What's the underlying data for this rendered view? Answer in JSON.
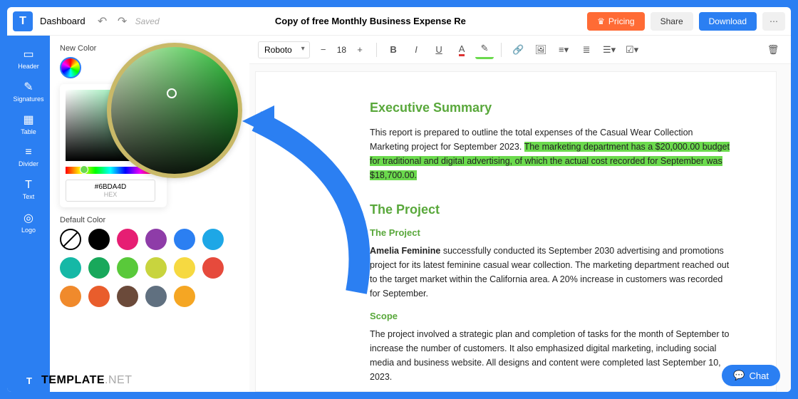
{
  "topbar": {
    "dashboard": "Dashboard",
    "saved": "Saved",
    "title": "Copy of free Monthly Business Expense Re",
    "pricing": "Pricing",
    "share": "Share",
    "download": "Download"
  },
  "sidebar": {
    "items": [
      {
        "label": "Header"
      },
      {
        "label": "Signatures"
      },
      {
        "label": "Table"
      },
      {
        "label": "Divider"
      },
      {
        "label": "Text"
      },
      {
        "label": "Logo"
      }
    ]
  },
  "panel": {
    "newColorLabel": "New Color",
    "hex": "#6BDA4D",
    "hexLabel": "HEX",
    "defaultColorLabel": "Default Color",
    "swatches": [
      "#000000",
      "#e61e73",
      "#8e3ca8",
      "#2b7ff2",
      "#1ea7e6",
      "#15b8a6",
      "#18a85b",
      "#59c93a",
      "#c8d43e",
      "#f6d941",
      "#e64a3c",
      "#f08a2c",
      "#e95d2c",
      "#6b4a3a",
      "#607080",
      "#f5a623"
    ]
  },
  "toolbar": {
    "font": "Roboto",
    "size": "18"
  },
  "doc": {
    "h1": "Executive Summary",
    "p1a": "This report is prepared to outline the total expenses of the Casual Wear Collection Marketing project for September 2023. ",
    "p1b": "The marketing department has a $20,000.00 budget for traditional and digital advertising, of which the actual cost recorded for September was $18,700.00.",
    "h2": "The Project",
    "sh1": "The Project",
    "p2a": "Amelia Feminine",
    "p2b": " successfully conducted its September 2030 advertising and promotions project for its latest feminine casual wear collection. The marketing department reached out to the target market within the California area. A 20% increase in customers was recorded for September.",
    "sh2": "Scope",
    "p3": "The project involved a strategic plan and completion of tasks for the month of September to increase the number of customers. It also emphasized digital marketing, including social media and business website. All designs and content were completed last September 10, 2023."
  },
  "brand": {
    "name": "TEMPLATE",
    "suffix": ".NET"
  },
  "chat": {
    "label": "Chat"
  }
}
